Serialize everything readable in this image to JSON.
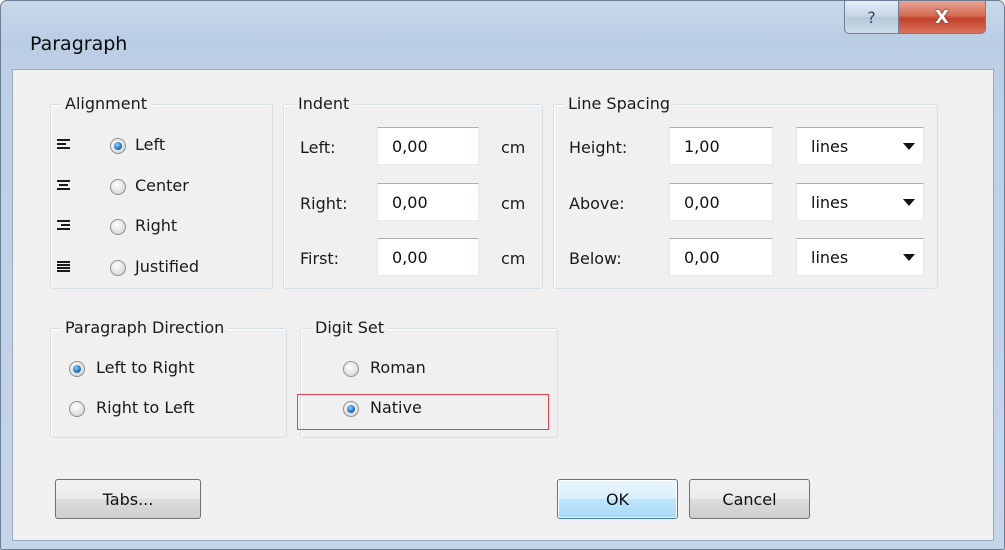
{
  "window": {
    "title": "Paragraph",
    "help_glyph": "?",
    "close_glyph": "X"
  },
  "alignment": {
    "label": "Alignment",
    "options": [
      {
        "label": "Left",
        "icon": "align-left-icon",
        "checked": true
      },
      {
        "label": "Center",
        "icon": "align-center-icon",
        "checked": false
      },
      {
        "label": "Right",
        "icon": "align-right-icon",
        "checked": false
      },
      {
        "label": "Justified",
        "icon": "align-justify-icon",
        "checked": false
      }
    ]
  },
  "indent": {
    "label": "Indent",
    "unit": "cm",
    "rows": [
      {
        "label": "Left:",
        "value": "0,00"
      },
      {
        "label": "Right:",
        "value": "0,00"
      },
      {
        "label": "First:",
        "value": "0,00"
      }
    ]
  },
  "line_spacing": {
    "label": "Line Spacing",
    "rows": [
      {
        "label": "Height:",
        "value": "1,00",
        "unit": "lines"
      },
      {
        "label": "Above:",
        "value": "0,00",
        "unit": "lines"
      },
      {
        "label": "Below:",
        "value": "0,00",
        "unit": "lines"
      }
    ]
  },
  "direction": {
    "label": "Paragraph Direction",
    "options": [
      {
        "label": "Left to Right",
        "checked": true
      },
      {
        "label": "Right to Left",
        "checked": false
      }
    ]
  },
  "digit_set": {
    "label": "Digit Set",
    "options": [
      {
        "label": "Roman",
        "checked": false
      },
      {
        "label": "Native",
        "checked": true
      }
    ]
  },
  "buttons": {
    "tabs": "Tabs...",
    "ok": "OK",
    "cancel": "Cancel"
  },
  "colors": {
    "highlight": "#e0454f",
    "accent": "#1f6fbf"
  }
}
